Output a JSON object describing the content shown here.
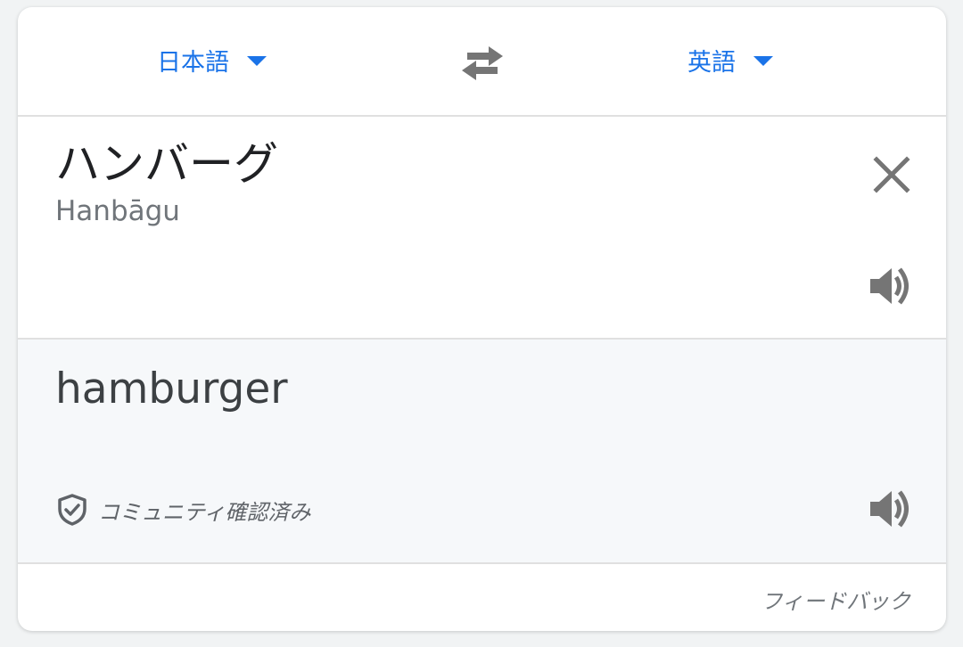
{
  "languages": {
    "source": "日本語",
    "target": "英語"
  },
  "source": {
    "text": "ハンバーグ",
    "transliteration": "Hanbāgu"
  },
  "result": {
    "text": "hamburger",
    "badge": "コミュニティ確認済み"
  },
  "footer": {
    "feedback": "フィードバック"
  },
  "icons": {
    "swap": "swap-arrows-icon",
    "clear": "close-icon",
    "speaker": "volume-icon",
    "verified": "shield-check-icon",
    "dropdown": "caret-down-icon"
  },
  "colors": {
    "accent": "#1a73e8",
    "icon": "#757575",
    "result_bg": "#f6f8fa"
  }
}
